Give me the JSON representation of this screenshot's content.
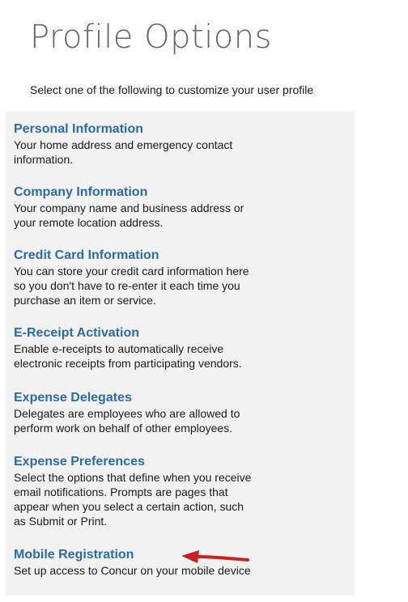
{
  "header": {
    "title": "Profile Options",
    "subtitle": "Select one of the following to customize your user profile"
  },
  "options": [
    {
      "title": "Personal Information",
      "description": "Your home address and emergency contact\ninformation."
    },
    {
      "title": "Company Information",
      "description": "Your company name and business address or\nyour remote location address."
    },
    {
      "title": "Credit Card Information",
      "description": "You can store your credit card information here\nso you don't have to re-enter it each time you\npurchase an item or service."
    },
    {
      "title": "E-Receipt Activation",
      "description": "Enable e-receipts to automatically receive\nelectronic receipts from participating vendors."
    },
    {
      "title": "Expense Delegates",
      "description": "Delegates are employees who are allowed to\nperform work on behalf of other employees."
    },
    {
      "title": "Expense Preferences",
      "description": "Select the options that define when you receive\nemail notifications. Prompts are pages that\nappear when you select a certain action, such\nas Submit or Print."
    },
    {
      "title": "Mobile Registration",
      "description": "Set up access to Concur on your mobile device"
    }
  ],
  "annotation": {
    "icon": "red-arrow-left-icon",
    "color": "#cc1f1f"
  },
  "colors": {
    "link": "#2b6ca8",
    "title": "#666666",
    "panel_background": "#f2f2f2"
  }
}
